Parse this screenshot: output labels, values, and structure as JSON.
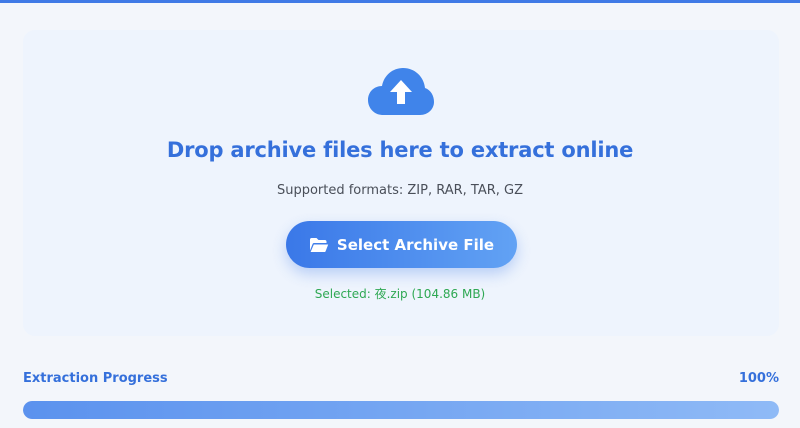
{
  "dropzone": {
    "title": "Drop archive files here to extract online",
    "formats": "Supported formats: ZIP, RAR, TAR, GZ",
    "select_button_label": "Select Archive File",
    "selected_file": "Selected: 夜.zip (104.86 MB)",
    "icons": {
      "upload": "cloud-upload-icon",
      "folder": "folder-open-icon"
    }
  },
  "progress": {
    "label": "Extraction Progress",
    "value_text": "100%",
    "fraction": 1.0
  },
  "colors": {
    "accent": "#3570db",
    "success": "#2ea853",
    "background": "#f3f6fb"
  }
}
